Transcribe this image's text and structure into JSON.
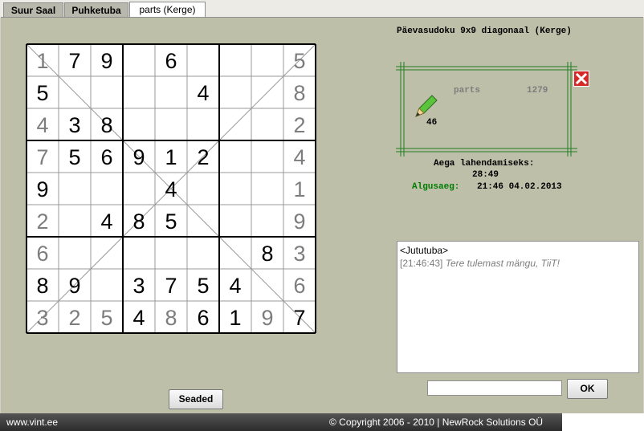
{
  "tabs": [
    {
      "label": "Suur Saal",
      "active": false
    },
    {
      "label": "Puhketuba",
      "active": false
    },
    {
      "label": "parts (Kerge)",
      "active": true
    }
  ],
  "game": {
    "title": "Päevasudoku 9x9 diagonaal (Kerge)",
    "player": {
      "name": "parts",
      "score": "1279",
      "moves": "46"
    },
    "timer_label": "Aega lahendamiseks:",
    "timer_value": "28:49",
    "start_label": "Algusaeg:",
    "start_value": "21:46 04.02.2013",
    "settings_button": "Seaded"
  },
  "colors": {
    "given": "#7d7d7d",
    "entered": "#000000",
    "start_label": "#007d00",
    "panel": "#bdbfa9"
  },
  "board": {
    "size": 9,
    "cells": [
      [
        "1g",
        "7",
        "9",
        "",
        "6",
        "",
        "",
        "",
        "5g"
      ],
      [
        "5",
        "",
        "",
        "",
        "",
        "4",
        "",
        "",
        "8g"
      ],
      [
        "4g",
        "3",
        "8",
        "",
        "",
        "",
        "",
        "",
        "2g"
      ],
      [
        "7g",
        "5",
        "6",
        "9",
        "1",
        "2",
        "",
        "",
        "4g"
      ],
      [
        "9",
        "",
        "",
        "",
        "4",
        "",
        "",
        "",
        "1g"
      ],
      [
        "2g",
        "",
        "4",
        "8",
        "5",
        "",
        "",
        "",
        "9g"
      ],
      [
        "6g",
        "",
        "",
        "",
        "",
        "",
        "",
        "8",
        "3g"
      ],
      [
        "8",
        "9",
        "",
        "3",
        "7",
        "5",
        "4",
        "",
        "6g"
      ],
      [
        "3g",
        "2g",
        "5g",
        "4",
        "8g",
        "6",
        "1",
        "9g",
        "7"
      ]
    ]
  },
  "chat": {
    "title": "<Jututuba>",
    "messages": [
      {
        "time": "[21:46:43]",
        "text": "Tere tulemast mängu, TiiT!"
      }
    ],
    "ok_label": "OK"
  },
  "footer": {
    "site": "www.vint.ee",
    "copyright": "© Copyright 2006 - 2010 | NewRock Solutions OÜ"
  }
}
